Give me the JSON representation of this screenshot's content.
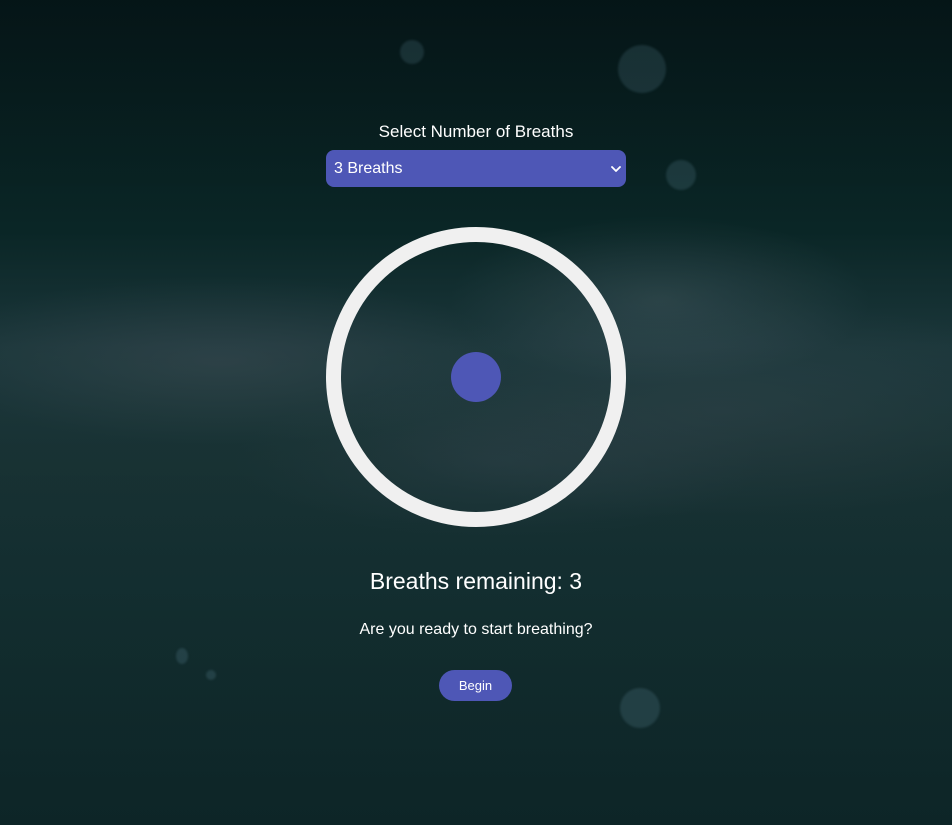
{
  "breath_selector": {
    "title": "Select Number of Breaths",
    "selected_value": "3 Breaths",
    "chevron_icon": "chevron-down-icon"
  },
  "breathing_circle": {
    "ring_color": "#f0f0f0",
    "dot_color": "#4e57b6"
  },
  "status": {
    "remaining_text": "Breaths remaining: 3",
    "prompt_text": "Are you ready to start breathing?"
  },
  "actions": {
    "begin_label": "Begin"
  },
  "colors": {
    "accent": "#4e57b6",
    "text": "#ffffff"
  }
}
